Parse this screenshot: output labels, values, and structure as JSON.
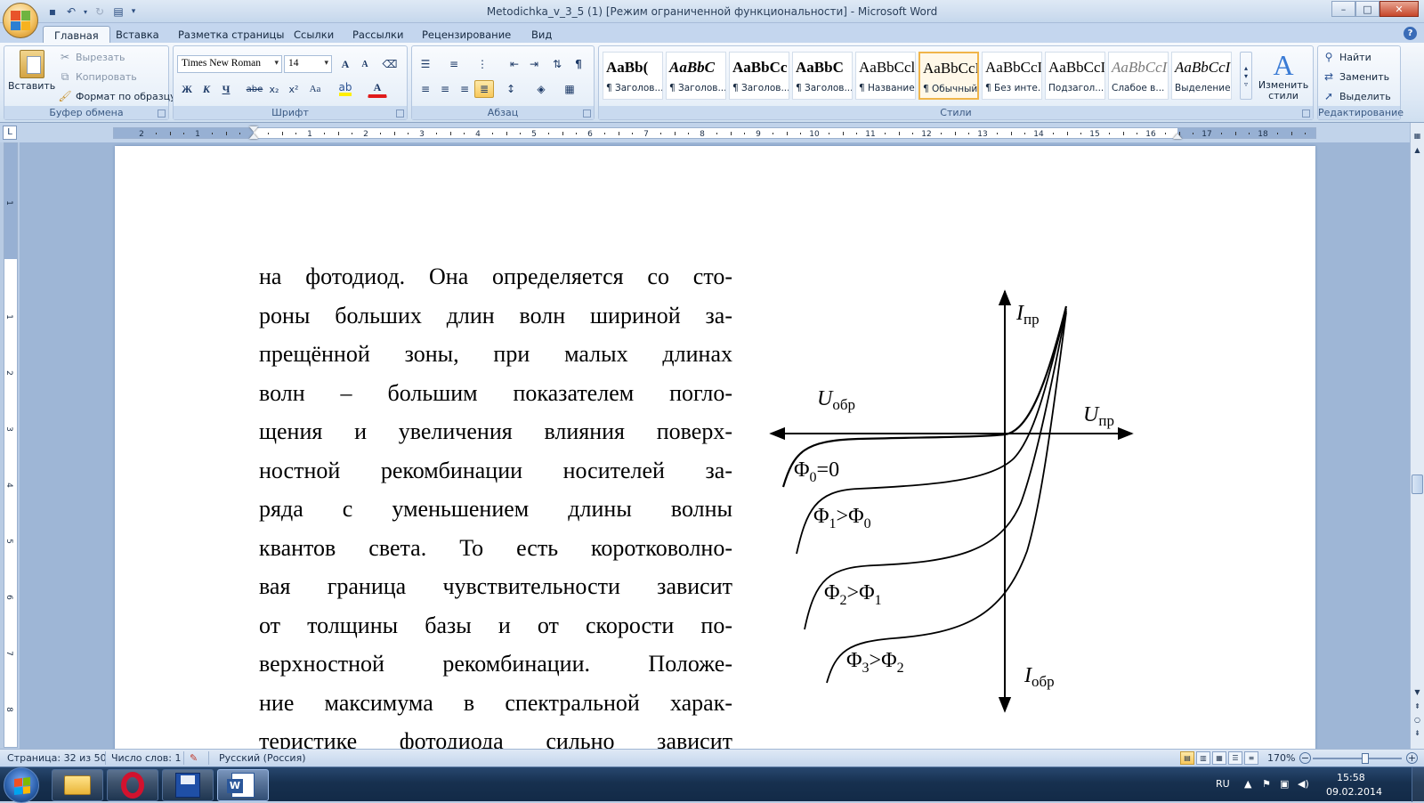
{
  "window": {
    "title": "Metodichka_v_3_5 (1) [Режим ограниченной функциональности] - Microsoft Word",
    "controls": [
      "–",
      "□",
      "✕"
    ]
  },
  "tabs": [
    "Главная",
    "Вставка",
    "Разметка страницы",
    "Ссылки",
    "Рассылки",
    "Рецензирование",
    "Вид"
  ],
  "active_tab": "Главная",
  "ribbon": {
    "clipboard": {
      "label": "Буфер обмена",
      "paste": "Вставить",
      "cut": "Вырезать",
      "copy": "Копировать",
      "format_painter": "Формат по образцу"
    },
    "font": {
      "label": "Шрифт",
      "font_name": "Times New Roman",
      "font_size": "14",
      "bold": "Ж",
      "italic": "К",
      "underline": "Ч",
      "strike": "abe",
      "subscript": "x₂",
      "superscript": "x²",
      "change_case": "Aa",
      "grow": "A",
      "shrink": "A",
      "font_color": "A"
    },
    "paragraph": {
      "label": "Абзац",
      "pilcrow": "¶"
    },
    "styles": {
      "label": "Стили",
      "items": [
        {
          "sample": "AaBb(",
          "name": "¶ Заголов...",
          "bold": true
        },
        {
          "sample": "AaBbC",
          "name": "¶ Заголов...",
          "bold": true
        },
        {
          "sample": "AaBbCc",
          "name": "¶ Заголов...",
          "bold": true
        },
        {
          "sample": "AaBbC",
          "name": "¶ Заголов...",
          "bold": true
        },
        {
          "sample": "AaBbCcl",
          "name": "¶ Название",
          "bold": false
        },
        {
          "sample": "AaBbCcI",
          "name": "¶ Обычный",
          "bold": false
        },
        {
          "sample": "AaBbCcI",
          "name": "¶ Без инте...",
          "bold": false
        },
        {
          "sample": "AaBbCcI",
          "name": "Подзагол...",
          "bold": false
        },
        {
          "sample": "AaBbCcI",
          "name": "Слабое в...",
          "bold": false
        },
        {
          "sample": "AaBbCcI",
          "name": "Выделение",
          "bold": false
        }
      ],
      "selected_index": 5,
      "change_styles": "Изменить стили"
    },
    "editing": {
      "label": "Редактирование",
      "find": "Найти",
      "replace": "Заменить",
      "select": "Выделить"
    }
  },
  "ruler": {
    "h_numbers": [
      "2",
      "1",
      "1",
      "2",
      "3",
      "4",
      "5",
      "6",
      "7",
      "8",
      "9",
      "10",
      "11",
      "12",
      "13",
      "14",
      "15",
      "16",
      "17",
      "18"
    ],
    "v_numbers": [
      "1",
      "1",
      "2",
      "3",
      "4",
      "5",
      "6",
      "7",
      "8"
    ]
  },
  "document": {
    "lines": [
      "на фотодиод. Она определяется со сто-",
      "роны больших длин волн шириной за-",
      "прещённой зоны, при малых длинах",
      "волн – большим показателем погло-",
      "щения и увеличения влияния поверх-",
      "ностной рекомбинации носителей за-",
      "ряда с уменьшением длины волны",
      "квантов света. То есть коротковолно-",
      "вая граница чувствительности зависит",
      "от толщины базы и от скорости по-",
      "верхностной рекомбинации. Положе-",
      "ние максимума в спектральной харак-",
      "теристике фотодиода сильно зависит"
    ],
    "figure": {
      "axis_labels": {
        "i_forward": {
          "main": "I",
          "sub": "пр"
        },
        "u_reverse": {
          "main": "U",
          "sub": "обр"
        },
        "u_forward": {
          "main": "U",
          "sub": "пр"
        },
        "i_reverse": {
          "main": "I",
          "sub": "обр"
        }
      },
      "curve_labels": [
        {
          "a": "Φ",
          "as": "0",
          "op": "=0",
          "b": "",
          "bs": ""
        },
        {
          "a": "Φ",
          "as": "1",
          "op": ">",
          "b": "Φ",
          "bs": "0"
        },
        {
          "a": "Φ",
          "as": "2",
          "op": ">",
          "b": "Φ",
          "bs": "1"
        },
        {
          "a": "Φ",
          "as": "3",
          "op": ">",
          "b": "Φ",
          "bs": "2"
        }
      ]
    }
  },
  "status": {
    "page": "Страница: 32 из 50",
    "words": "Число слов: 1",
    "language": "Русский (Россия)",
    "zoom": "170%",
    "zoom_minus": "−",
    "zoom_plus": "+"
  },
  "taskbar": {
    "lang": "RU",
    "time": "15:58",
    "date": "09.02.2014",
    "apps": [
      "explorer",
      "opera",
      "save-app",
      "word"
    ]
  },
  "colors": {
    "accent": "#f0b54a",
    "ribbon_bg": "#dde8f5",
    "opera_red": "#d2122e",
    "word_blue": "#2b579a"
  }
}
